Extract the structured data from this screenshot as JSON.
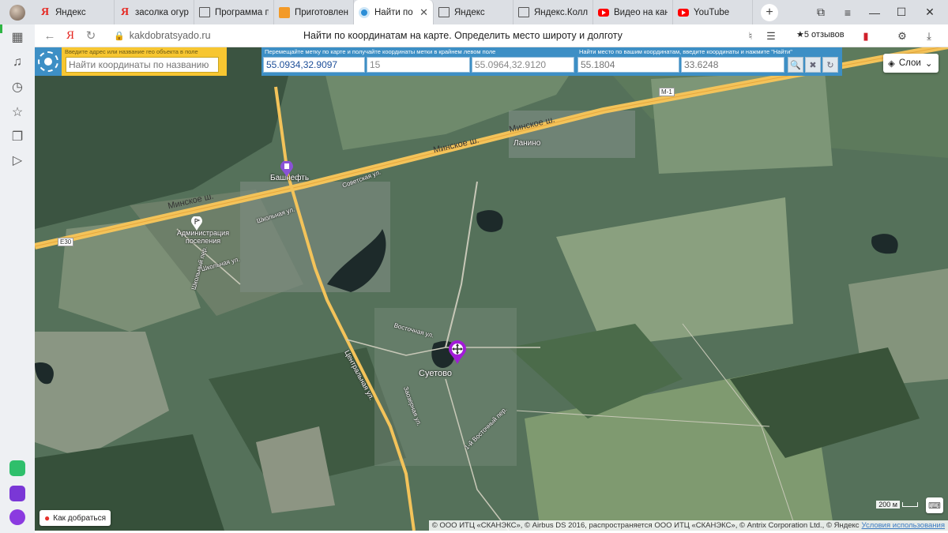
{
  "tabs": [
    {
      "label": "Яндекс",
      "icon": "yandex-icon",
      "active": false
    },
    {
      "label": "засолка огурц",
      "icon": "yandex-icon",
      "active": false
    },
    {
      "label": "Программа пе",
      "icon": "doc-icon",
      "active": false
    },
    {
      "label": "Приготовлени",
      "icon": "orange-tab-icon",
      "active": false
    },
    {
      "label": "Найти по коорд",
      "icon": "site-icon",
      "active": true
    },
    {
      "label": "Яндекс",
      "icon": "doc-icon",
      "active": false
    },
    {
      "label": "Яндекс.Коллек",
      "icon": "doc-icon",
      "active": false
    },
    {
      "label": "Видео на кана",
      "icon": "youtube-icon",
      "active": false
    },
    {
      "label": "YouTube",
      "icon": "youtube-icon",
      "active": false
    }
  ],
  "window": {
    "minimize": "—",
    "maximize": "☐",
    "close": "✕"
  },
  "addressbar": {
    "url": "kakdobratsyado.ru",
    "page_title": "Найти по координатам на карте. Определить место широту и долготу",
    "reviews": "★5 отзывов"
  },
  "panel": {
    "search_hint": "Введите адрес или название гео объекта в поле",
    "search_placeholder": "Найти координаты по названию",
    "marker_hint": "Перемещайте метку по карте и получайте координаты метки в крайнем левом поле",
    "marker_coords": "55.0934,32.9097",
    "zoom": "15",
    "center_coords": "55.0964,32.9120",
    "find_hint": "Найти место по вашим координатам, введите координаты и нажмите \"Найти\"",
    "lat_placeholder": "55.1804",
    "lon_placeholder": "33.6248"
  },
  "map": {
    "layers_label": "Слои",
    "howto_label": "Как добраться",
    "scale_label": "200 м",
    "copyright": "© ООО ИТЦ «СКАНЭКС», © Airbus DS 2016, распространяется ООО ИТЦ «СКАНЭКС», © Antrix Corporation Ltd., © Яндекс",
    "terms_link": "Условия использования",
    "labels": {
      "highway1": "Минское ш.",
      "highway2": "Минское ш.",
      "highway3": "Минское ш.",
      "village1": "Ланино",
      "village2": "Суетово",
      "station": "Башнефть",
      "admin": "Администрация поселения",
      "street1": "Центральная ул.",
      "street2": "Школьная ул.",
      "street3": "Школьная ул.",
      "street4": "Школьный пер.",
      "street5": "Восточная ул.",
      "street6": "Заозерная ул.",
      "street7": "1-й Восточный пер.",
      "street8": "Советская ул.",
      "e30": "E30",
      "m1": "M-1"
    }
  }
}
